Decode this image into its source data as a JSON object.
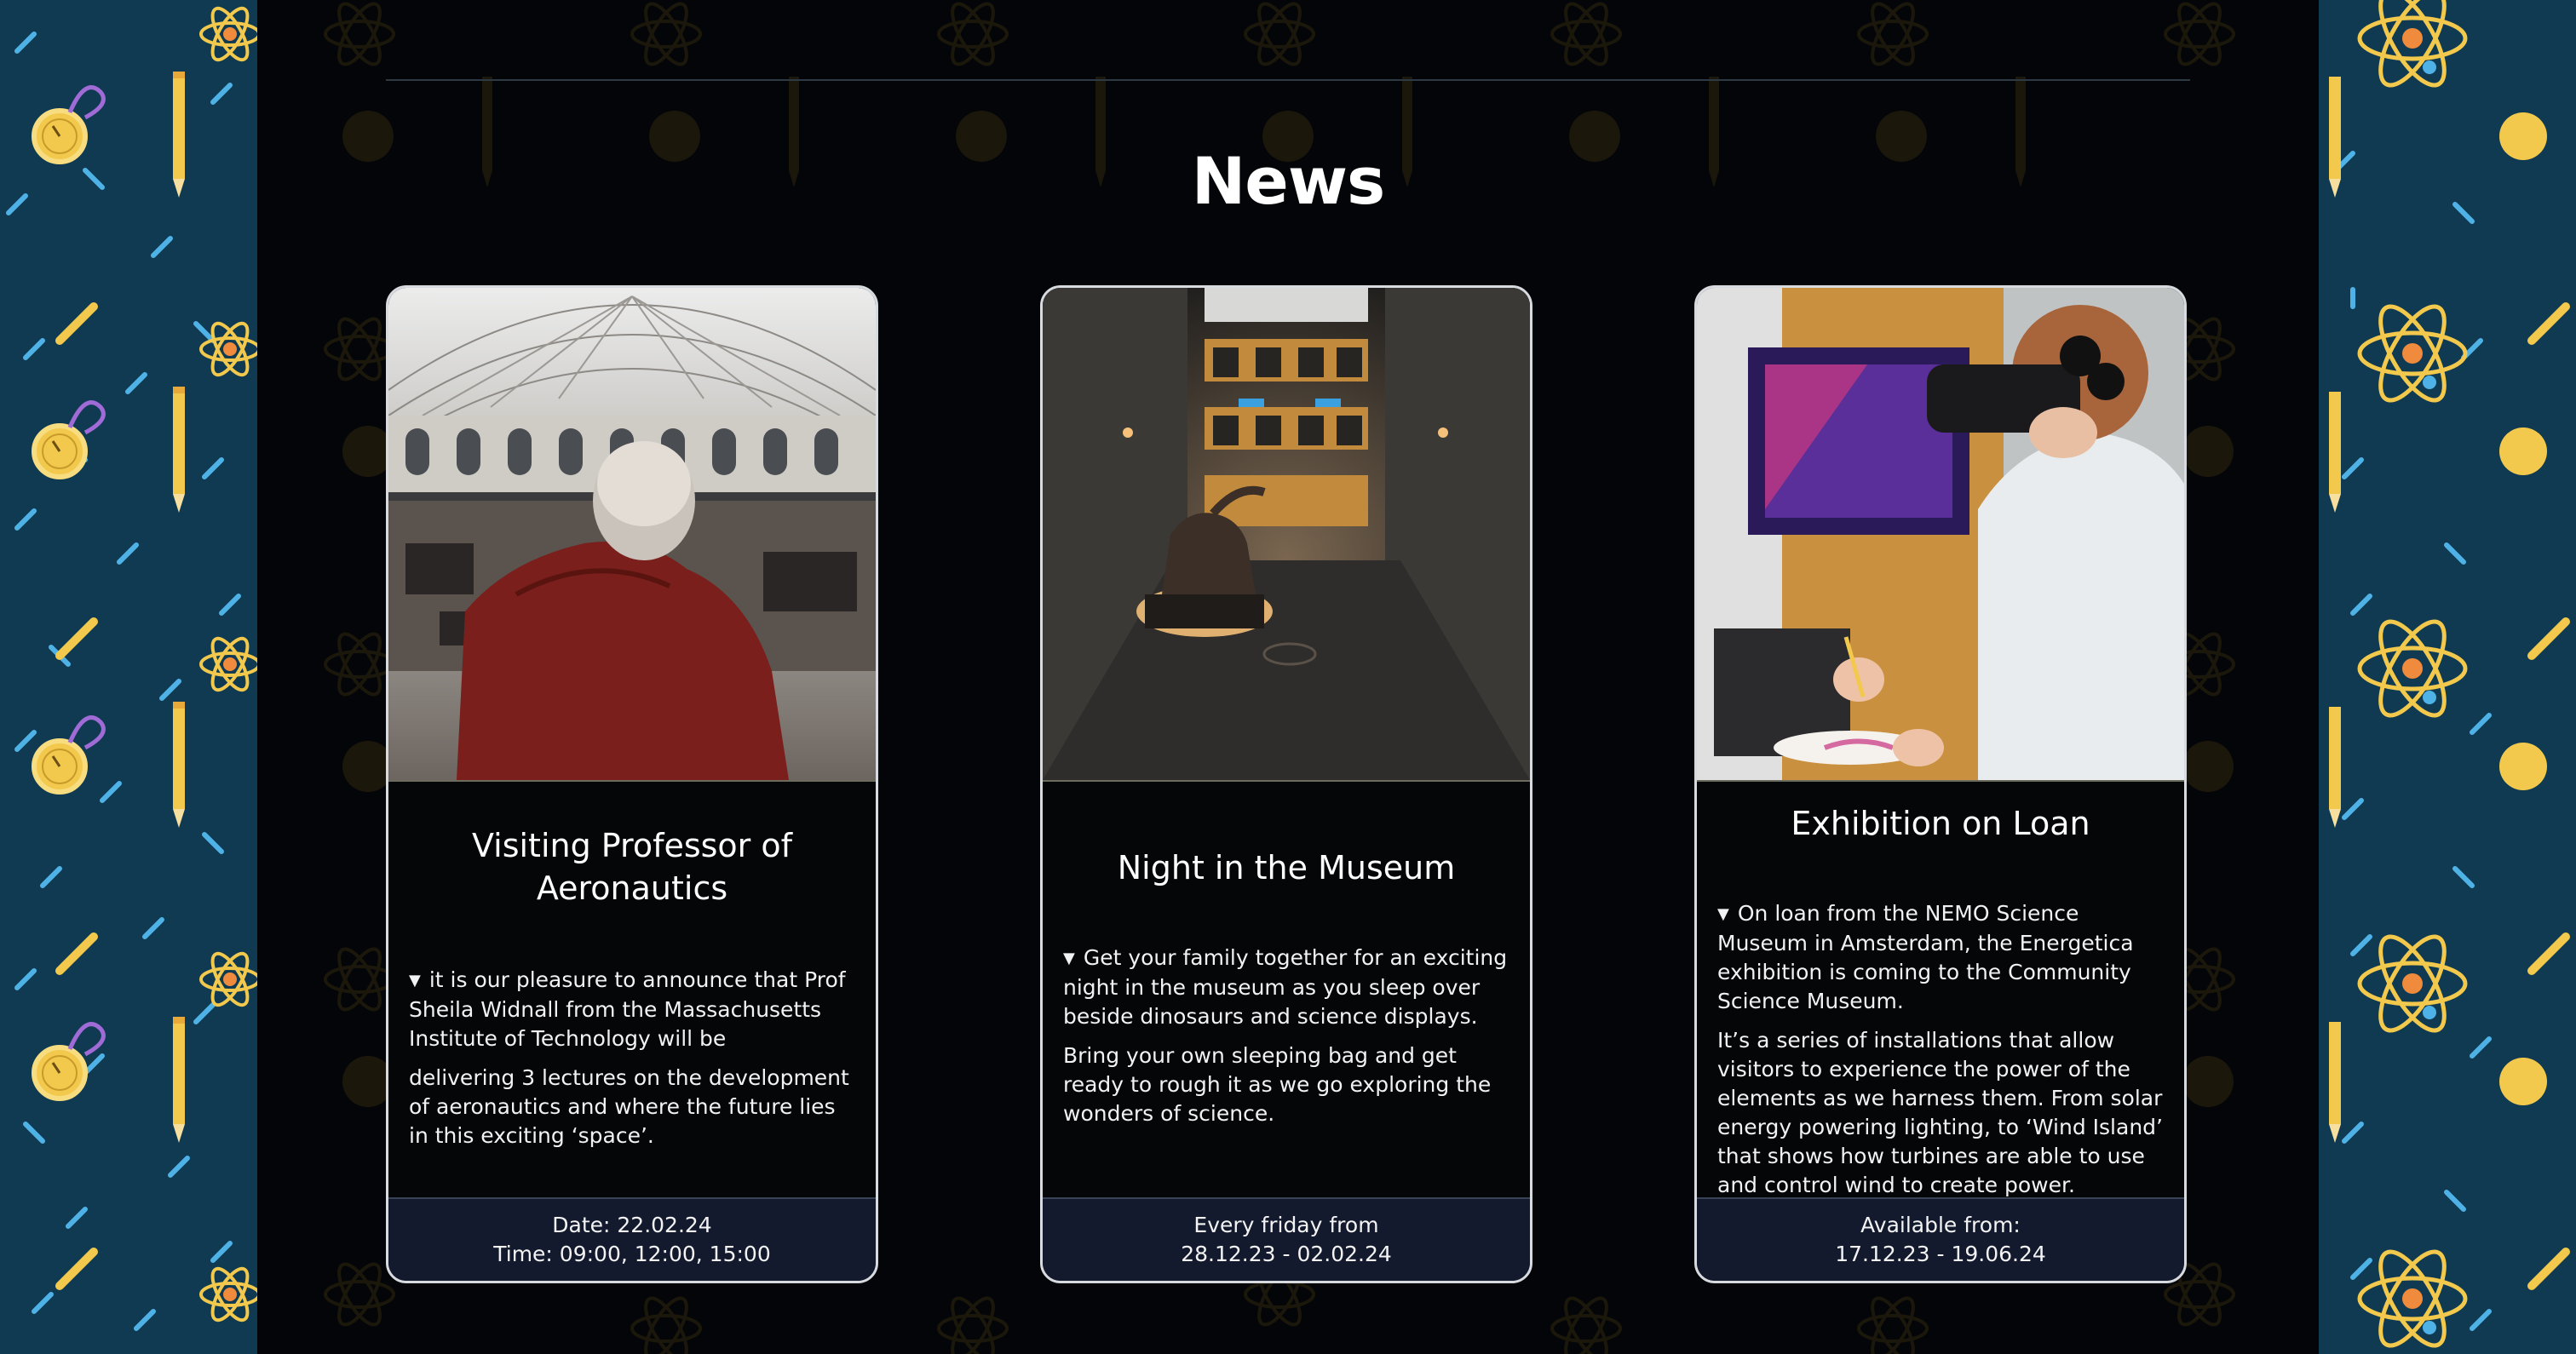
{
  "page": {
    "title": "News"
  },
  "colors": {
    "side_bg": "#0f3a52",
    "main_bg": "#030508",
    "card_border": "#d7dbe0",
    "footer_bg": "#131a2e",
    "accent": "#f2c94c"
  },
  "cards": [
    {
      "title": "Visiting Professor of Aeronautics",
      "paragraphs": [
        "it is our pleasure to announce that Prof Sheila Widnall from the Massachusetts Institute of Technology will be",
        "delivering 3 lectures on the development of aeronautics and where the future lies in this exciting ‘space’."
      ],
      "footer_line1": "Date: 22.02.24",
      "footer_line2": "Time: 09:00, 12:00, 15:00",
      "image": "rotunda-interior-photo"
    },
    {
      "title": "Night in the Museum",
      "paragraphs": [
        "Get your family together for an exciting night in the museum as you sleep over beside dinosaurs and science displays.",
        "Bring your own sleeping bag and get ready to rough it as we go exploring the wonders of science."
      ],
      "footer_line1": "Every friday from",
      "footer_line2": "28.12.23 - 02.02.24",
      "image": "museum-hall-dinosaur-photo"
    },
    {
      "title": "Exhibition on Loan",
      "paragraphs": [
        "On loan from the NEMO Science Museum in Amsterdam, the Energetica exhibition is coming to the Community Science Museum.",
        "It’s a series of installations that allow visitors to experience the power of the elements as we harness them. From solar energy powering lighting, to ‘Wind Island’ that shows how turbines are able to use and control wind to create power."
      ],
      "footer_line1": "Available from:",
      "footer_line2": "17.12.23 - 19.06.24",
      "image": "vr-headset-photo"
    }
  ],
  "icons": [
    "atom-icon",
    "stopwatch-icon",
    "pencil-icon",
    "arrow-down-icon"
  ]
}
